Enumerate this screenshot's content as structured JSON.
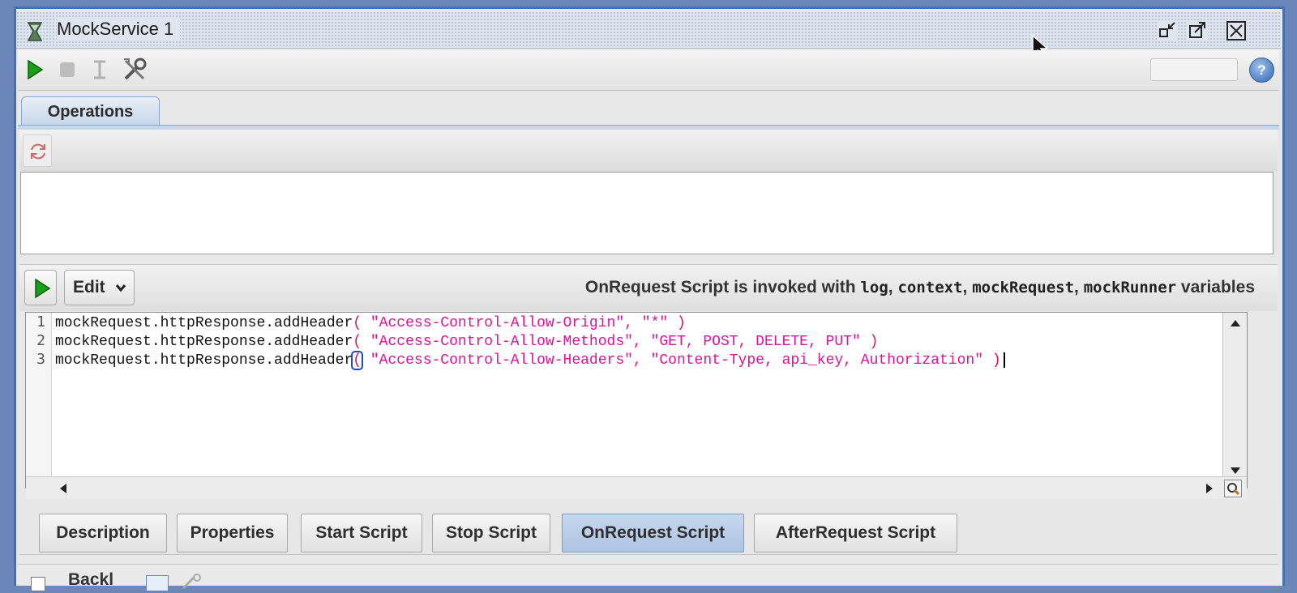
{
  "window": {
    "title": "MockService 1",
    "controls": [
      "minimize-icon",
      "maximize-icon",
      "close-icon"
    ]
  },
  "toolbar": {
    "buttons": [
      "run-icon",
      "stop-icon",
      "options-icon",
      "tools-icon"
    ],
    "search_value": "",
    "help_label": "?"
  },
  "operations": {
    "tab_label": "Operations",
    "toolbar_icon": "refresh-icon",
    "items": []
  },
  "script": {
    "edit_label": "Edit",
    "description_prefix": "OnRequest Script is invoked with ",
    "var_log": "log",
    "sep1": ", ",
    "var_context": "context",
    "sep2": ", ",
    "var_mockRequest": "mockRequest",
    "sep3": ", ",
    "var_mockRunner": "mockRunner",
    "description_suffix": " variables",
    "lines": [
      {
        "num": "1",
        "prefix": "mockRequest.httpResponse.addHeader",
        "open": "(",
        "args": " \"Access-Control-Allow-Origin\", \"*\" ",
        "close": ")"
      },
      {
        "num": "2",
        "prefix": "mockRequest.httpResponse.addHeader",
        "open": "(",
        "args": " \"Access-Control-Allow-Methods\", \"GET, POST, DELETE, PUT\" ",
        "close": ")"
      },
      {
        "num": "3",
        "prefix": "mockRequest.httpResponse.addHeader",
        "open": "(",
        "args": " \"Access-Control-Allow-Headers\", \"Content-Type, api_key, Authorization\" ",
        "close": ")"
      }
    ]
  },
  "bottom_tabs": {
    "description": "Description",
    "properties": "Properties",
    "start_script": "Start Script",
    "stop_script": "Stop Script",
    "onrequest_script": "OnRequest Script",
    "afterrequest_script": "AfterRequest Script",
    "active": "OnRequest Script"
  },
  "bottom_strip": {
    "label": "Backl"
  },
  "colors": {
    "title_frame": "#4a6fb0",
    "string_literal": "#e0119b",
    "active_tab": "#adc4e3"
  }
}
